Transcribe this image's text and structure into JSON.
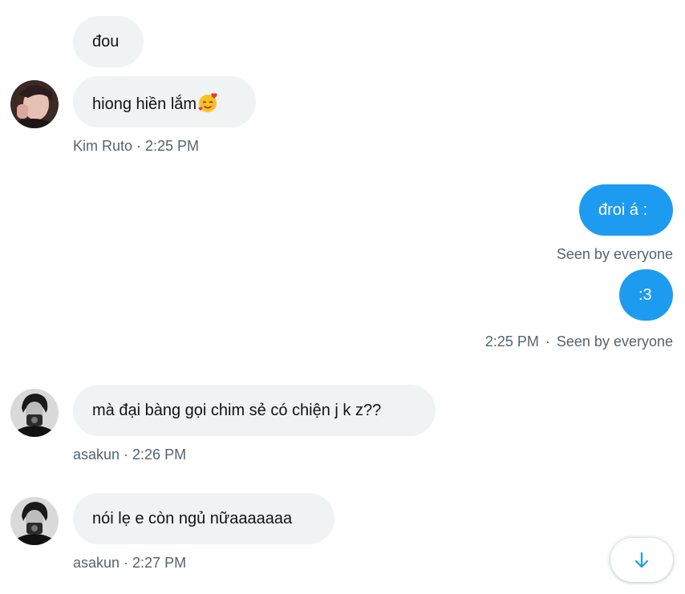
{
  "messages": [
    {
      "text": "đou"
    },
    {
      "text": "hiong hiền lắm",
      "emoji": "🥰"
    },
    {
      "meta": "Kim Ruto · 2:25 PM"
    },
    {
      "text": "đroi á :"
    },
    {
      "meta": "Seen by everyone"
    },
    {
      "text": ":3"
    },
    {
      "meta_time": "2:25 PM",
      "meta_sep": "·",
      "meta_seen": "Seen by everyone"
    },
    {
      "text": "mà đại bàng gọi chim sẻ có chiện j k z??"
    },
    {
      "meta": "asakun · 2:26 PM"
    },
    {
      "text": "nói lẹ e còn ngủ nữaaaaaaa"
    },
    {
      "meta": "asakun · 2:27 PM"
    }
  ],
  "colors": {
    "incoming_bubble": "#eff3f4",
    "outgoing_bubble": "#1d9bf0",
    "meta_text": "#536471",
    "accent": "#1d9bf0"
  },
  "icons": {
    "scroll_down": "arrow-down-icon"
  }
}
